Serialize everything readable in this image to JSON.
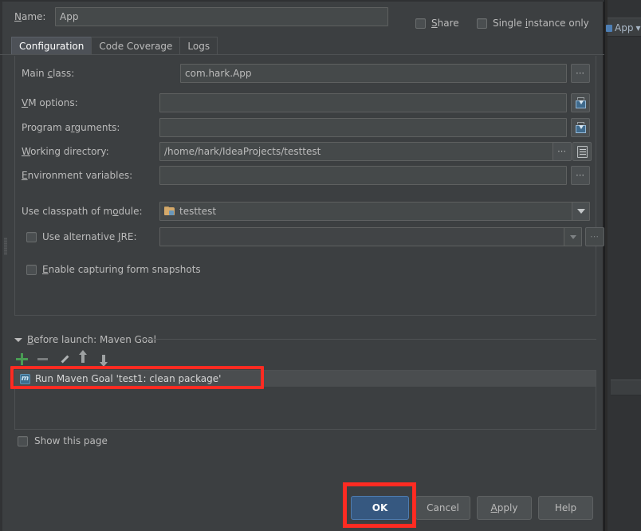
{
  "background_ide": {
    "run_config_name": "App",
    "dropdown_icon": "chevron-down-icon",
    "module_icon": "module-icon"
  },
  "dialog": {
    "name_row": {
      "label": "Name:",
      "value": "App",
      "placeholder": "",
      "share": {
        "label": "Share",
        "checked": false
      },
      "single_instance": {
        "label": "Single instance only",
        "checked": false
      }
    },
    "tabs": [
      {
        "label": "Configuration",
        "selected": true
      },
      {
        "label": "Code Coverage",
        "selected": false
      },
      {
        "label": "Logs",
        "selected": false
      }
    ],
    "fields": {
      "main_class": {
        "label": "Main class:",
        "value": "com.hark.App",
        "browse_label": "...",
        "browse_icon": "ellipsis-icon"
      },
      "vm_options": {
        "label": "VM options:",
        "value": "",
        "expand_icon": "expand-editor-icon"
      },
      "program_arguments": {
        "label": "Program arguments:",
        "value": "",
        "expand_icon": "expand-editor-icon"
      },
      "working_directory": {
        "label": "Working directory:",
        "value": "/home/hark/IdeaProjects/testtest",
        "browse_label": "...",
        "browse_icon": "ellipsis-icon",
        "macro_icon": "macros-list-icon"
      },
      "environment_variables": {
        "label": "Environment variables:",
        "value": "",
        "browse_label": "...",
        "browse_icon": "ellipsis-icon"
      },
      "use_classpath_of_module": {
        "label": "Use classpath of module:",
        "value": "testtest",
        "icon": "module-folder-icon",
        "dropdown_icon": "chevron-down-icon"
      },
      "use_alternative_jre": {
        "label": "Use alternative JRE:",
        "checked": false,
        "value": "",
        "dropdown_icon": "chevron-down-icon",
        "browse_label": "...",
        "browse_icon": "ellipsis-icon"
      },
      "enable_capturing_form_snapshots": {
        "label": "Enable capturing form snapshots",
        "checked": false
      }
    },
    "before_launch": {
      "title": "Before launch: Maven Goal",
      "collapse_icon": "caret-down-icon",
      "toolbar": [
        {
          "name": "add",
          "icon": "plus-icon",
          "label": "+"
        },
        {
          "name": "remove",
          "icon": "minus-icon",
          "label": "−"
        },
        {
          "name": "edit",
          "icon": "pencil-icon",
          "label": ""
        },
        {
          "name": "move-up",
          "icon": "arrow-up-icon",
          "label": ""
        },
        {
          "name": "move-down",
          "icon": "arrow-down-icon",
          "label": ""
        }
      ],
      "items": [
        {
          "icon": "maven-icon",
          "icon_glyph": "m",
          "label": "Run Maven Goal 'test1: clean package'",
          "selected": true
        }
      ]
    },
    "show_this_page": {
      "label": "Show this page",
      "checked": false
    },
    "buttons": [
      {
        "name": "ok",
        "label": "OK",
        "default": true
      },
      {
        "name": "cancel",
        "label": "Cancel",
        "default": false
      },
      {
        "name": "apply",
        "label": "Apply",
        "default": false
      },
      {
        "name": "help",
        "label": "Help",
        "default": false
      }
    ]
  },
  "annotations": {
    "highlight_color": "#fe2b22",
    "highlight_targets": [
      "before-launch-maven-goal-row",
      "ok-button"
    ]
  },
  "colors": {
    "dialog_bg": "#3c3f41",
    "field_bg": "#45494a",
    "text": "#bbbbbb",
    "accent_blue": "#365880",
    "selected_tab": "#4d5157",
    "highlight_red": "#fe2b22"
  }
}
